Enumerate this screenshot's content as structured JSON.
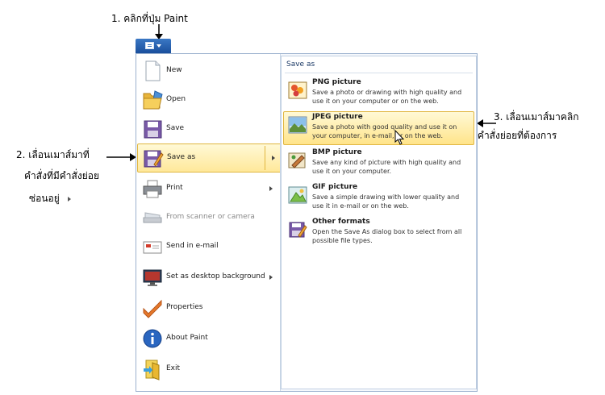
{
  "annotations": {
    "step1": "1. คลิกที่ปุ่ม Paint",
    "step2_line1": "2. เลื่อนเมาส์มาที่",
    "step2_line2": "คำสั่งที่มีคำสั่งย่อย",
    "step2_line3": "ซ่อนอยู่",
    "step3_line1": "3. เลื่อนเมาส์มาคลิก",
    "step3_line2": "ที่คำสั่งย่อยที่ต้องการ"
  },
  "menu": {
    "items": [
      {
        "label": "New",
        "icon": "new-document-icon"
      },
      {
        "label": "Open",
        "icon": "open-folder-icon"
      },
      {
        "label": "Save",
        "icon": "floppy-disk-icon"
      },
      {
        "label": "Save as",
        "icon": "save-as-icon",
        "has_submenu": true,
        "highlighted": true
      },
      {
        "label": "Print",
        "icon": "printer-icon",
        "has_submenu": true
      },
      {
        "label": "From scanner or camera",
        "icon": "scanner-icon",
        "disabled": true
      },
      {
        "label": "Send in e-mail",
        "icon": "email-icon"
      },
      {
        "label": "Set as desktop background",
        "icon": "monitor-icon",
        "has_submenu": true
      },
      {
        "label": "Properties",
        "icon": "checkmark-icon"
      },
      {
        "label": "About Paint",
        "icon": "info-icon"
      },
      {
        "label": "Exit",
        "icon": "exit-icon"
      }
    ]
  },
  "save_as": {
    "header": "Save as",
    "items": [
      {
        "title": "PNG picture",
        "desc": "Save a photo or drawing with high quality and use it on your computer or on the web.",
        "icon": "png-image-icon"
      },
      {
        "title": "JPEG picture",
        "desc": "Save a photo with good quality and use it on your computer, in e-mail, or on the web.",
        "icon": "jpeg-image-icon",
        "highlighted": true
      },
      {
        "title": "BMP picture",
        "desc": "Save any kind of picture with high quality and use it on your computer.",
        "icon": "bmp-image-icon"
      },
      {
        "title": "GIF picture",
        "desc": "Save a simple drawing with lower quality and use it in e-mail or on the web.",
        "icon": "gif-image-icon"
      },
      {
        "title": "Other formats",
        "desc": "Open the Save As dialog box to select from all possible file types.",
        "icon": "other-formats-icon"
      }
    ]
  },
  "colors": {
    "accent": "#1a4f9c",
    "highlight": "#ffe89a",
    "highlight_border": "#e0b640"
  }
}
